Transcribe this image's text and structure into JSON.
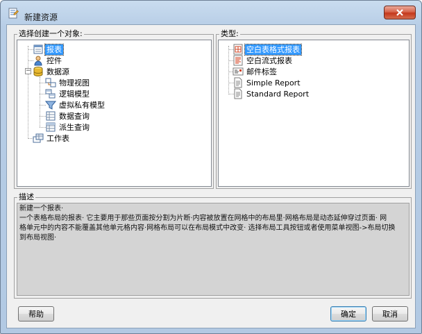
{
  "window": {
    "title": "新建资源"
  },
  "left_panel": {
    "legend": "选择创建一个对象:",
    "items": [
      {
        "label": "报表",
        "icon": "report-icon",
        "selected": true
      },
      {
        "label": "控件",
        "icon": "control-icon"
      },
      {
        "label": "数据源",
        "icon": "database-icon"
      },
      {
        "label": "物理视图",
        "icon": "physical-view-icon"
      },
      {
        "label": "逻辑模型",
        "icon": "logical-model-icon"
      },
      {
        "label": "虚拟私有模型",
        "icon": "virtual-private-model-icon"
      },
      {
        "label": "数据查询",
        "icon": "data-query-icon"
      },
      {
        "label": "派生查询",
        "icon": "derived-query-icon"
      },
      {
        "label": "工作表",
        "icon": "worksheet-icon"
      }
    ]
  },
  "right_panel": {
    "legend": "类型:",
    "items": [
      {
        "label": "空白表格式报表",
        "icon": "table-report-icon",
        "selected": true
      },
      {
        "label": "空白流式报表",
        "icon": "flow-report-icon"
      },
      {
        "label": "邮件标签",
        "icon": "mail-label-icon"
      },
      {
        "label": "Simple Report",
        "icon": "simple-report-icon"
      },
      {
        "label": "Standard Report",
        "icon": "standard-report-icon"
      }
    ]
  },
  "description": {
    "legend": "描述",
    "lines": [
      "新建一个报表·",
      "一个表格布局的报表· 它主要用于那些页面按分割为片断·内容被放置在网格中的布局里·网格布局是动态延伸穿过页面· 网",
      "格单元中的内容不能覆盖其他单元格内容·网格布局可以在布局模式中改变· 选择布局工具按钮或者使用菜单视图->布局切换",
      "到布局视图·"
    ]
  },
  "buttons": {
    "help": "帮助",
    "ok": "确定",
    "cancel": "取消"
  },
  "colors": {
    "selection": "#3399ff",
    "close_button": "#c4381c"
  }
}
